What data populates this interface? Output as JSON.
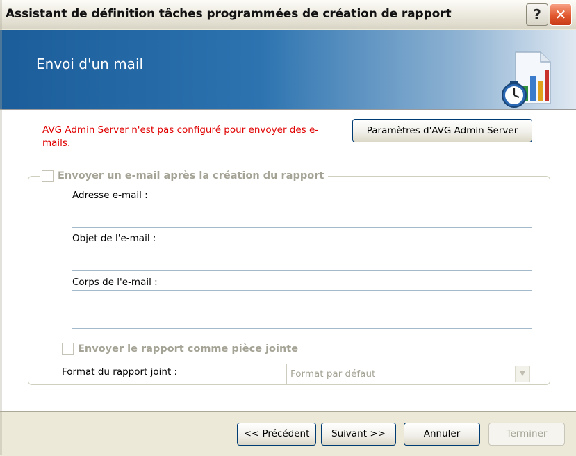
{
  "window": {
    "title": "Assistant de définition tâches programmées de création de rapport",
    "help_label": "?",
    "close_label": "✕"
  },
  "banner": {
    "title": "Envoi d'un mail",
    "icon": "report-schedule-icon"
  },
  "content": {
    "warning": "AVG Admin Server n'est pas configuré pour envoyer des e-mails.",
    "server_settings_button": "Paramètres d'AVG Admin Server",
    "send_email_checkbox": {
      "label": "Envoyer un e-mail après la création du rapport",
      "checked": false,
      "enabled": false
    },
    "fields": {
      "address": {
        "label": "Adresse e-mail :",
        "value": ""
      },
      "subject": {
        "label": "Objet de l'e-mail :",
        "value": ""
      },
      "body": {
        "label": "Corps de l'e-mail :",
        "value": ""
      }
    },
    "attach_checkbox": {
      "label": "Envoyer le rapport comme pièce jointe",
      "checked": false,
      "enabled": false
    },
    "format": {
      "label": "Format du rapport joint :",
      "value": "Format par défaut",
      "enabled": false
    }
  },
  "footer": {
    "previous": "<< Précédent",
    "next": "Suivant >>",
    "cancel": "Annuler",
    "finish": "Terminer"
  },
  "colors": {
    "warning": "#e00000",
    "banner_start": "#1b5d9a",
    "disabled_text": "#a4a395"
  }
}
